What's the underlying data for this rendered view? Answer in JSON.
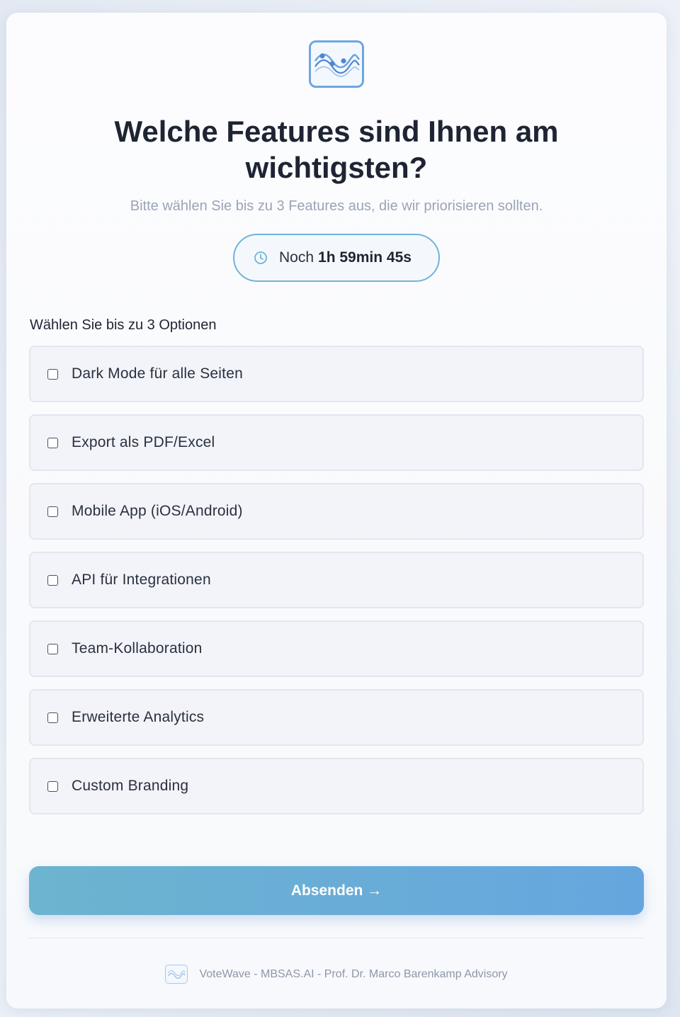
{
  "app": {
    "logo_icon": "wave-logo-icon",
    "accent_color": "#6ea6e0"
  },
  "question": {
    "title": "Welche Features sind Ihnen am wichtigsten?",
    "subtitle": "Bitte wählen Sie bis zu 3 Features aus, die wir priorisieren sollten."
  },
  "timer": {
    "icon": "clock-icon",
    "prefix": "Noch",
    "time": "1h 59min 45s"
  },
  "options": {
    "label": "Wählen Sie bis zu 3 Optionen",
    "items": [
      {
        "label": "Dark Mode für alle Seiten",
        "checked": false
      },
      {
        "label": "Export als PDF/Excel",
        "checked": false
      },
      {
        "label": "Mobile App (iOS/Android)",
        "checked": false
      },
      {
        "label": "API für Integrationen",
        "checked": false
      },
      {
        "label": "Team-Kollaboration",
        "checked": false
      },
      {
        "label": "Erweiterte Analytics",
        "checked": false
      },
      {
        "label": "Custom Branding",
        "checked": false
      }
    ]
  },
  "submit": {
    "label": "Absenden →"
  },
  "footer": {
    "text": "VoteWave - MBSAS.AI - Prof. Dr. Marco Barenkamp Advisory"
  }
}
